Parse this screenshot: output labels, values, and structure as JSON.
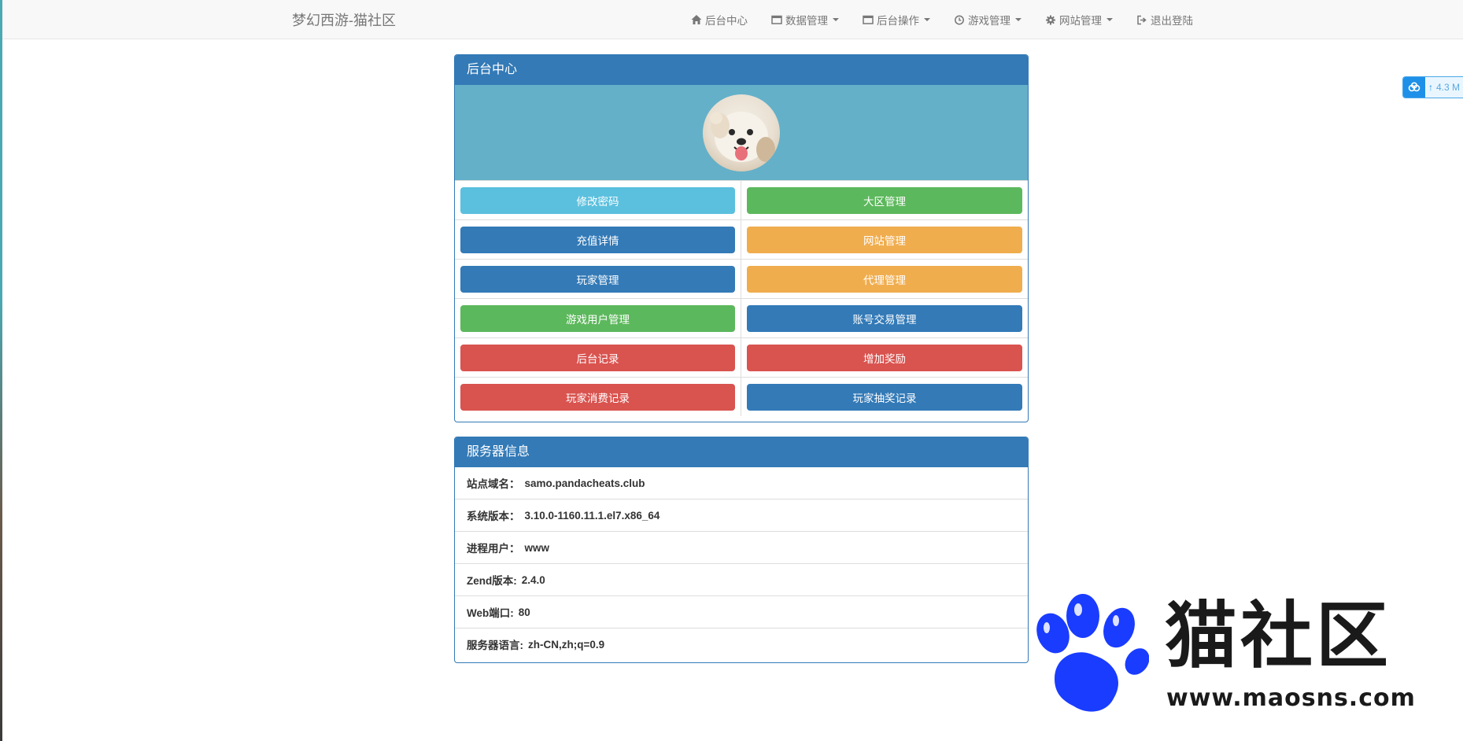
{
  "navbar": {
    "brand": "梦幻西游-猫社区",
    "items": [
      {
        "label": "后台中心",
        "icon": "home-icon",
        "dropdown": false
      },
      {
        "label": "数据管理",
        "icon": "window-icon",
        "dropdown": true
      },
      {
        "label": "后台操作",
        "icon": "window-icon",
        "dropdown": true
      },
      {
        "label": "游戏管理",
        "icon": "clock-icon",
        "dropdown": true
      },
      {
        "label": "网站管理",
        "icon": "gear-icon",
        "dropdown": true
      },
      {
        "label": "退出登陆",
        "icon": "logout-icon",
        "dropdown": false
      }
    ]
  },
  "admin_panel": {
    "title": "后台中心",
    "buttons": [
      {
        "label": "修改密码",
        "style": "info"
      },
      {
        "label": "大区管理",
        "style": "success"
      },
      {
        "label": "充值详情",
        "style": "primary"
      },
      {
        "label": "网站管理",
        "style": "warning"
      },
      {
        "label": "玩家管理",
        "style": "primary"
      },
      {
        "label": "代理管理",
        "style": "warning"
      },
      {
        "label": "游戏用户管理",
        "style": "success"
      },
      {
        "label": "账号交易管理",
        "style": "primary"
      },
      {
        "label": "后台记录",
        "style": "danger"
      },
      {
        "label": "增加奖励",
        "style": "danger"
      },
      {
        "label": "玩家消费记录",
        "style": "danger"
      },
      {
        "label": "玩家抽奖记录",
        "style": "primary"
      }
    ]
  },
  "server_panel": {
    "title": "服务器信息",
    "rows": [
      {
        "label": "站点域名：",
        "value": "samo.pandacheats.club"
      },
      {
        "label": "系统版本：",
        "value": "3.10.0-1160.11.1.el7.x86_64"
      },
      {
        "label": "进程用户：",
        "value": "www"
      },
      {
        "label": "Zend版本:",
        "value": "2.4.0"
      },
      {
        "label": "Web端口:",
        "value": "80"
      },
      {
        "label": "服务器语言:",
        "value": "zh-CN,zh;q=0.9"
      }
    ]
  },
  "upload_widget": {
    "text": "4.3 M"
  },
  "watermark": {
    "name": "猫社区",
    "url": "www.maosns.com"
  },
  "colors": {
    "primary": "#337ab7",
    "info": "#5bc0de",
    "success": "#5cb85c",
    "warning": "#f0ad4e",
    "danger": "#d9534f",
    "avatar_band": "#64b0c8"
  }
}
